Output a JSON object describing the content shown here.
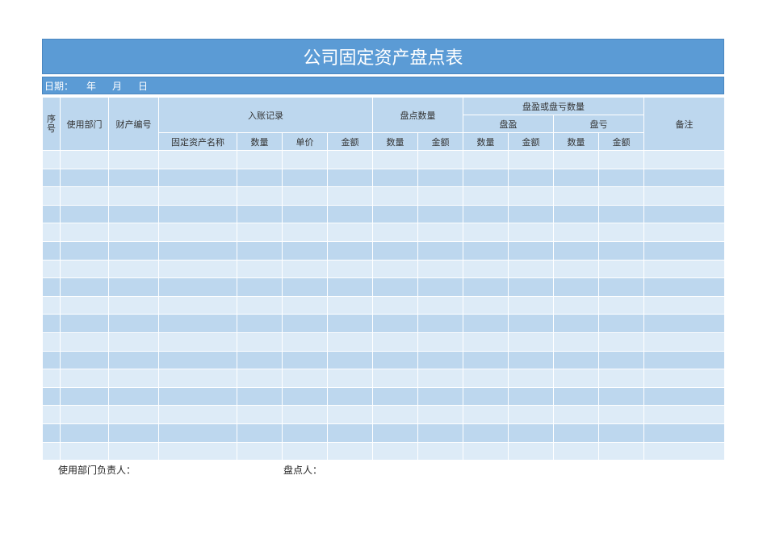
{
  "title": "公司固定资产盘点表",
  "date_line": {
    "label": "日期：",
    "year": "年",
    "month": "月",
    "day": "日"
  },
  "headers": {
    "seq": "序号",
    "seq_top": "序",
    "seq_bottom": "号",
    "department": "使用部门",
    "asset_no": "财产编号",
    "ledger": "入账记录",
    "stock_count": "盘点数量",
    "surplus_deficit_qty": "盘盈或盘亏数量",
    "surplus": "盘盈",
    "deficit": "盘亏",
    "remarks": "备注",
    "asset_name": "固定资产名称",
    "quantity": "数量",
    "unit_price": "单价",
    "amount": "金额"
  },
  "row_count": 17,
  "footer": {
    "department_manager": "使用部门负责人：",
    "counter": "盘点人："
  },
  "colors": {
    "title_bg": "#5b9bd5",
    "header_bg": "#bdd7ee",
    "row_light": "#ddebf7",
    "row_dark": "#bdd7ee"
  }
}
